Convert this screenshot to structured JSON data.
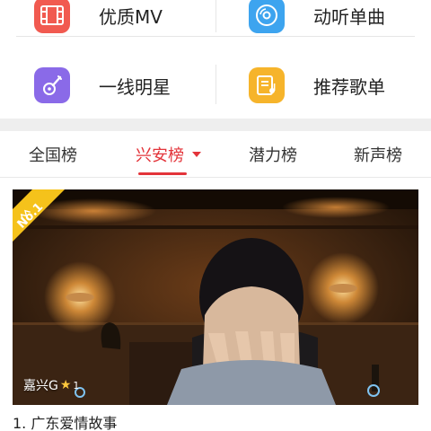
{
  "menu": {
    "items": [
      {
        "label": "优质MV",
        "icon": "film-icon",
        "color": "#f15a50"
      },
      {
        "label": "动听单曲",
        "icon": "disc-icon",
        "color": "#3da4ef"
      },
      {
        "label": "一线明星",
        "icon": "guitar-icon",
        "color": "#8a6ae8"
      },
      {
        "label": "推荐歌单",
        "icon": "playlist-icon",
        "color": "#f6b42b"
      }
    ]
  },
  "tabs": [
    {
      "label": "全国榜",
      "active": false
    },
    {
      "label": "兴安榜",
      "active": true
    },
    {
      "label": "潜力榜",
      "active": false
    },
    {
      "label": "新声榜",
      "active": false
    }
  ],
  "accent_color": "#e3343a",
  "featured": {
    "rank_badge": "No.1",
    "artist": "嘉兴G",
    "star_level": "1",
    "title": "1. 广东爱情故事"
  }
}
